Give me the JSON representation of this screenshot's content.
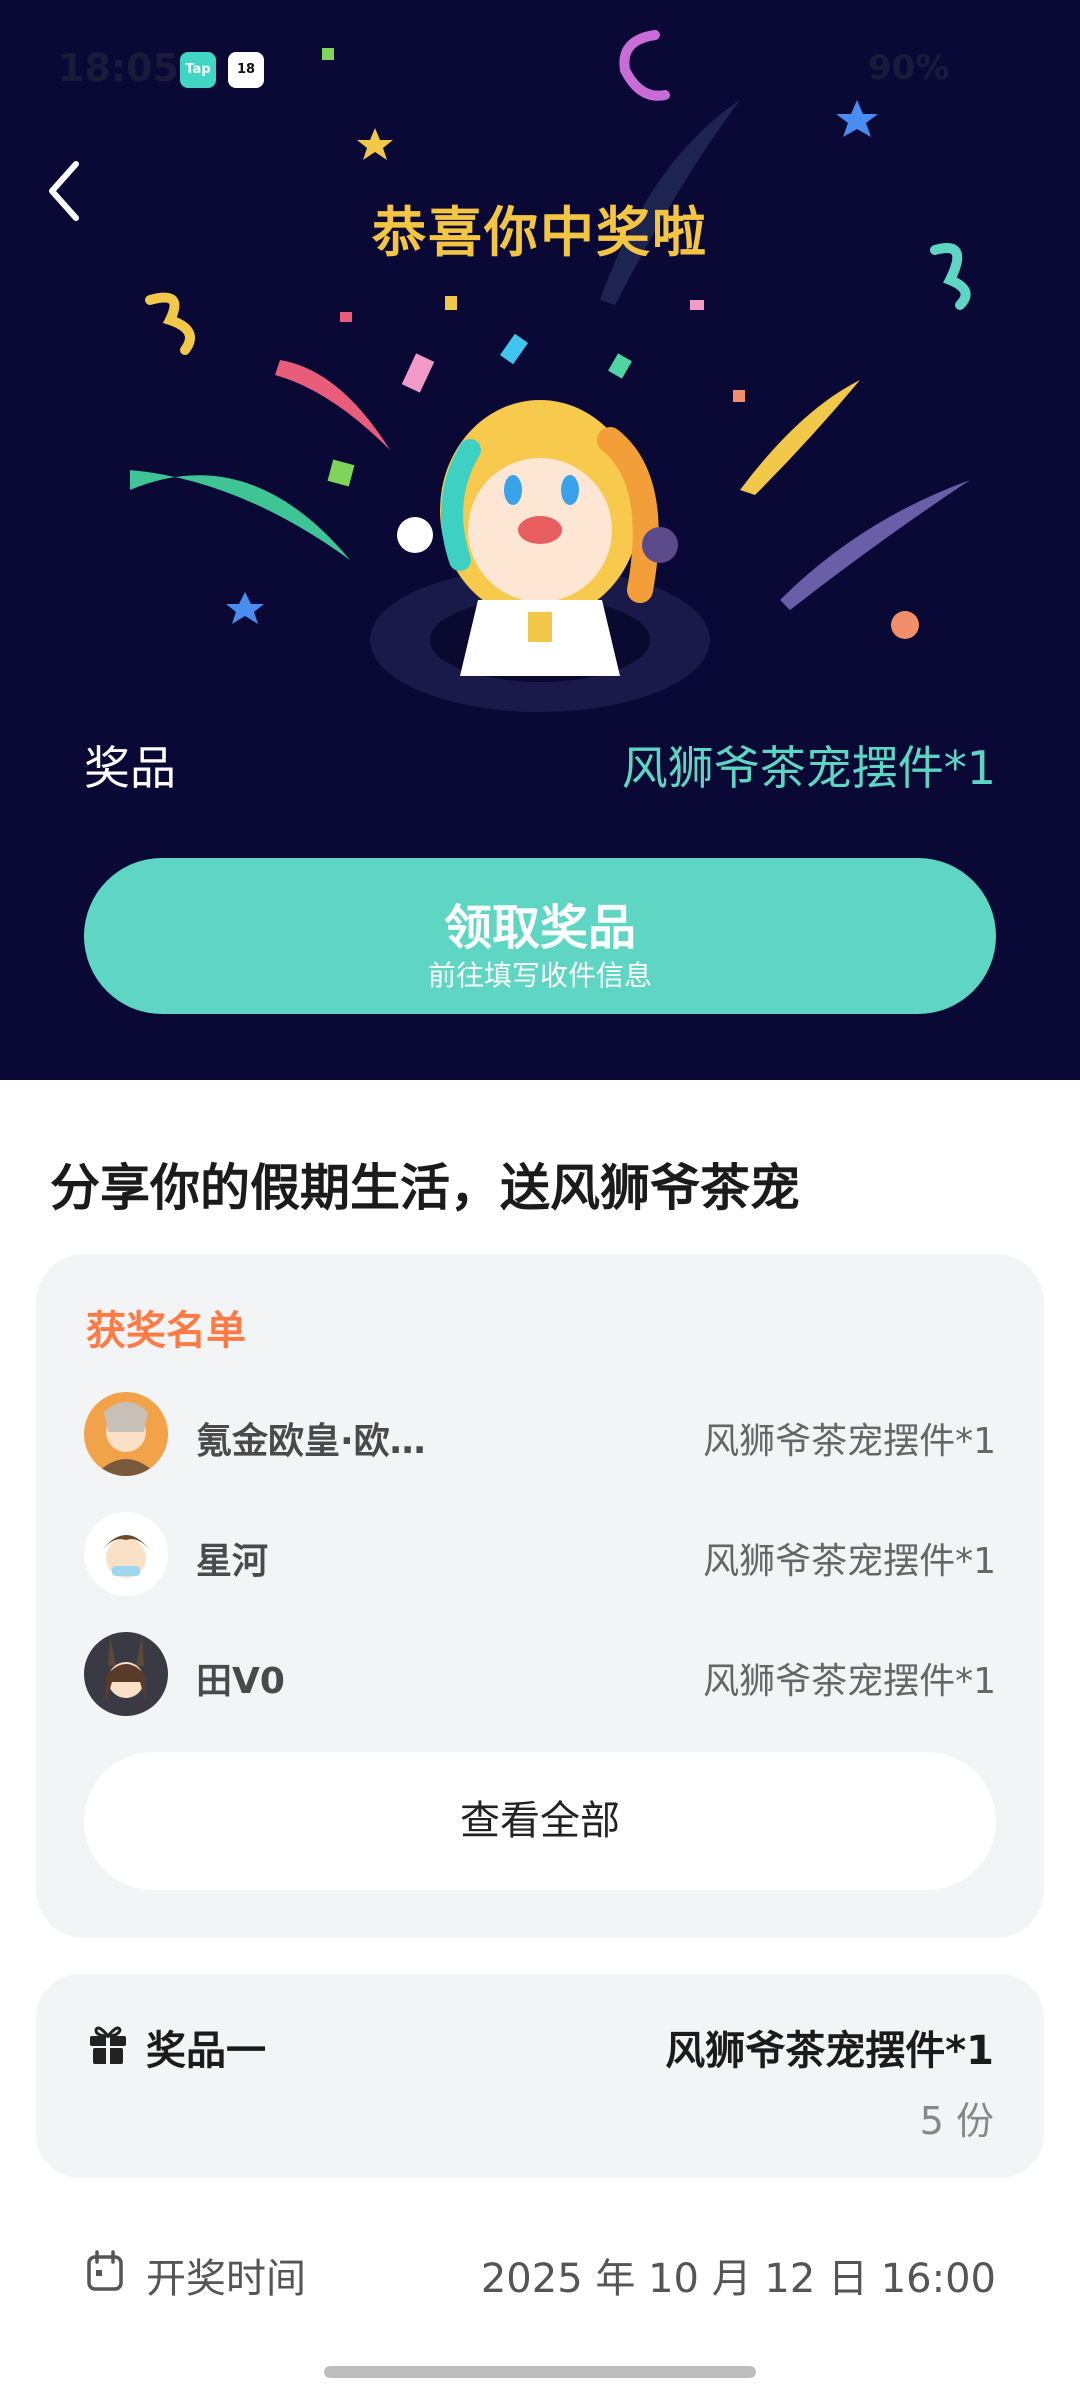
{
  "status_bar": {
    "time": "18:05",
    "app_badges": [
      "Tap",
      "18"
    ],
    "battery": "90%"
  },
  "hero": {
    "title": "恭喜你中奖啦",
    "prize_label": "奖品",
    "prize_value": "风狮爷茶宠摆件*1",
    "claim_button": {
      "title": "领取奖品",
      "subtitle": "前往填写收件信息"
    },
    "background_color": "#0a0935",
    "accent_color": "#5fd6c3"
  },
  "share_title": "分享你的假期生活，送风狮爷茶宠",
  "winners": {
    "heading": "获奖名单",
    "list": [
      {
        "name": "氪金欧皇·欧…",
        "prize": "风狮爷茶宠摆件*1",
        "avatar_icon": "avatar-anime-girl"
      },
      {
        "name": "星河",
        "prize": "风狮爷茶宠摆件*1",
        "avatar_icon": "avatar-anime-boy"
      },
      {
        "name": "田V0",
        "prize": "风狮爷茶宠摆件*1",
        "avatar_icon": "avatar-bunny-girl"
      }
    ],
    "view_all": "查看全部"
  },
  "prize_card": {
    "icon": "gift-icon",
    "label": "奖品一",
    "value": "风狮爷茶宠摆件*1",
    "count": "5 份"
  },
  "draw_time": {
    "icon": "calendar-icon",
    "label": "开奖时间",
    "value": "2025 年 10 月 12 日 16:00"
  }
}
